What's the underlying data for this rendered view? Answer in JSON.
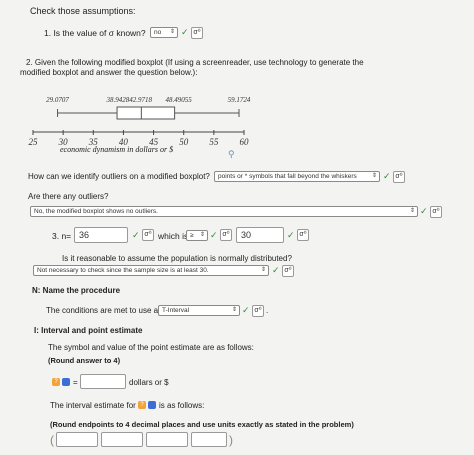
{
  "header": {
    "title": "Check those assumptions:"
  },
  "q1": {
    "label": "1. Is the value of σ known?",
    "select_value": "no",
    "arrow": "⇕",
    "check": "✓",
    "sigma": "σ⁰"
  },
  "q2": {
    "line1": "2. Given the following modified boxplot (If using a screenreader, use technology to generate the",
    "line2": "modified boxplot and answer the question below.):"
  },
  "boxplot": {
    "labels": {
      "min": "29.0707",
      "q1q2": "38.942842.9718",
      "q3": "48.49055",
      "max": "59.1724"
    },
    "values": {
      "min": 29.0707,
      "q1": 38.9428,
      "median": 42.9718,
      "q3": 48.49055,
      "max": 59.1724
    },
    "axis_min": 25,
    "axis_max": 60,
    "ticks": [
      "25",
      "30",
      "35",
      "40",
      "45",
      "50",
      "55",
      "60"
    ],
    "tick_values": [
      25,
      30,
      35,
      40,
      45,
      50,
      55,
      60
    ],
    "xlabel": "economic dynamism in dollars or $"
  },
  "outliers_q": {
    "question": "How can we identify outliers on a modified boxplot?",
    "answer": "points or * symbols that fall beyond the whiskers",
    "arrow": "⇕",
    "check": "✓",
    "sigma": "σ⁰"
  },
  "any_outliers": {
    "question": "Are there any outliers?",
    "answer": "No, the modified boxplot shows no outliers.",
    "arrow": "⇕",
    "check": "✓",
    "sigma": "σ⁰"
  },
  "q3": {
    "label": "3. n=",
    "value": "36",
    "check": "✓",
    "sigma": "σ⁰",
    "which_is": "which is",
    "compare": "≥",
    "arrow": "⇕",
    "check2": "✓",
    "sigma2": "σ⁰",
    "threshold": "30",
    "check3": "✓",
    "sigma3": "σ⁰"
  },
  "normal_q": {
    "question": "Is it reasonable to assume the population is normally distributed?",
    "answer": "Not necessary to check since the sample size is at least 30.",
    "arrow": "⇕",
    "check": "✓",
    "sigma": "σ⁰"
  },
  "procedure": {
    "heading": "N: Name the procedure",
    "text": "The conditions are met to use a",
    "answer": "T-Interval",
    "arrow": "⇕",
    "check": "✓",
    "sigma": "σ⁰",
    "period": "."
  },
  "interval": {
    "heading": "I: Interval and point estimate",
    "text": "The symbol and value of the point estimate are as follows:",
    "round": "(Round answer to 4)",
    "q_badge": "?",
    "eq": "=",
    "units": "dollars or $",
    "estimate_text": "The interval estimate for",
    "estimate_suffix": "is as follows:",
    "round2": "(Round endpoints to 4 decimal places and use units exactly as stated in the problem)",
    "paren_open": "(",
    "paren_close": ")"
  },
  "icons": {
    "search": "⚲"
  },
  "colors": {
    "check": "#2d8a3e",
    "badge_blue": "#3b6fd6",
    "badge_orange": "#f2a43a"
  }
}
